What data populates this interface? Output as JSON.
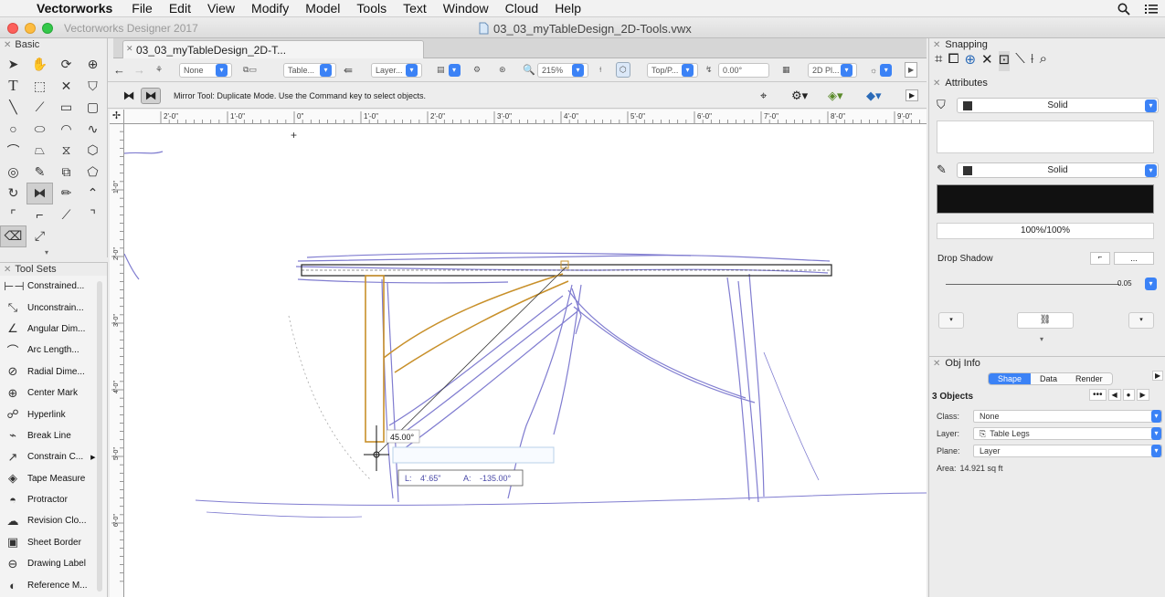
{
  "menubar": {
    "app_name": "Vectorworks",
    "items": [
      "File",
      "Edit",
      "View",
      "Modify",
      "Model",
      "Tools",
      "Text",
      "Window",
      "Cloud",
      "Help"
    ]
  },
  "titlebar": {
    "app_title": "Vectorworks Designer 2017",
    "document_title": "03_03_myTableDesign_2D-Tools.vwx"
  },
  "doc_tab": {
    "label": "03_03_myTableDesign_2D-T..."
  },
  "toolbar": {
    "class_value": "None",
    "layer_class_label": "Table...",
    "layer_label": "Layer...",
    "zoom": "215%",
    "view": "Top/P...",
    "rotation": "0.00°",
    "render_mode": "2D Pl..."
  },
  "mode_bar": {
    "message": "Mirror Tool: Duplicate Mode. Use the Command key to select objects."
  },
  "basic_palette": {
    "title": "Basic",
    "tools": [
      "select-arrow",
      "pan-hand",
      "flyover",
      "zoom",
      "text",
      "selection-rect",
      "x-cross",
      "attribute-bucket",
      "line",
      "slash",
      "rectangle",
      "rounded-rect",
      "circle",
      "oval",
      "arc",
      "freehand",
      "polyline",
      "polygon-fill",
      "double-line",
      "hexagon",
      "spiral",
      "eyedropper",
      "transform",
      "reshape",
      "rotate",
      "mirror",
      "pencil",
      "vertex",
      "fillet",
      "offset",
      "chamfer",
      "hook",
      "eraser",
      "split"
    ]
  },
  "tool_sets": {
    "title": "Tool Sets",
    "items": [
      {
        "label": "Constrained...",
        "icon": "constrained-dim-icon"
      },
      {
        "label": "Unconstrain...",
        "icon": "unconstrained-dim-icon"
      },
      {
        "label": "Angular Dim...",
        "icon": "angular-dim-icon"
      },
      {
        "label": "Arc Length...",
        "icon": "arc-length-icon"
      },
      {
        "label": "Radial Dime...",
        "icon": "radial-dim-icon"
      },
      {
        "label": "Center Mark",
        "icon": "center-mark-icon"
      },
      {
        "label": "Hyperlink",
        "icon": "hyperlink-icon"
      },
      {
        "label": "Break Line",
        "icon": "break-line-icon"
      },
      {
        "label": "Constrain C...",
        "icon": "constrain-c-icon"
      },
      {
        "label": "Tape Measure",
        "icon": "tape-measure-icon"
      },
      {
        "label": "Protractor",
        "icon": "protractor-icon"
      },
      {
        "label": "Revision Clo...",
        "icon": "revision-cloud-icon"
      },
      {
        "label": "Sheet Border",
        "icon": "sheet-border-icon"
      },
      {
        "label": "Drawing Label",
        "icon": "drawing-label-icon"
      },
      {
        "label": "Reference M...",
        "icon": "reference-marker-icon"
      }
    ]
  },
  "rulers": {
    "horizontal_ticks": [
      "2'-0\"",
      "1'-0\"",
      "0\"",
      "1'-0\"",
      "2'-0\"",
      "3'-0\"",
      "4'-0\"",
      "5'-0\"",
      "6'-0\"",
      "7'-0\"",
      "8'-0\"",
      "9'-0\""
    ],
    "vertical_ticks": [
      "1'-0\"",
      "2'-0\"",
      "3'-0\"",
      "4'-0\"",
      "5'-0\"",
      "6'-0\""
    ]
  },
  "canvas": {
    "angle_readout": "45.00°",
    "length_label": "L:",
    "length_value": "4'.65\"",
    "angle_label": "A:",
    "angle_value": "-135.00°"
  },
  "snapping": {
    "title": "Snapping"
  },
  "attributes": {
    "title": "Attributes",
    "fill_style": "Solid",
    "pen_style": "Solid",
    "opacity": "100%/100%",
    "drop_shadow_label": "Drop Shadow",
    "drop_shadow_button": "...",
    "line_weight": "0.05"
  },
  "obj_info": {
    "title": "Obj Info",
    "tabs": [
      "Shape",
      "Data",
      "Render"
    ],
    "active_tab": "Shape",
    "selection_count": "3 Objects",
    "class_label": "Class:",
    "class_value": "None",
    "layer_label": "Layer:",
    "layer_value": "Table Legs",
    "plane_label": "Plane:",
    "plane_value": "Layer",
    "area_label": "Area:",
    "area_value": "14.921 sq ft"
  },
  "colors": {
    "accent": "#3b82f6",
    "sketch": "#6a66c8",
    "construction": "#c8902a",
    "fill_swatch": "#111111"
  }
}
